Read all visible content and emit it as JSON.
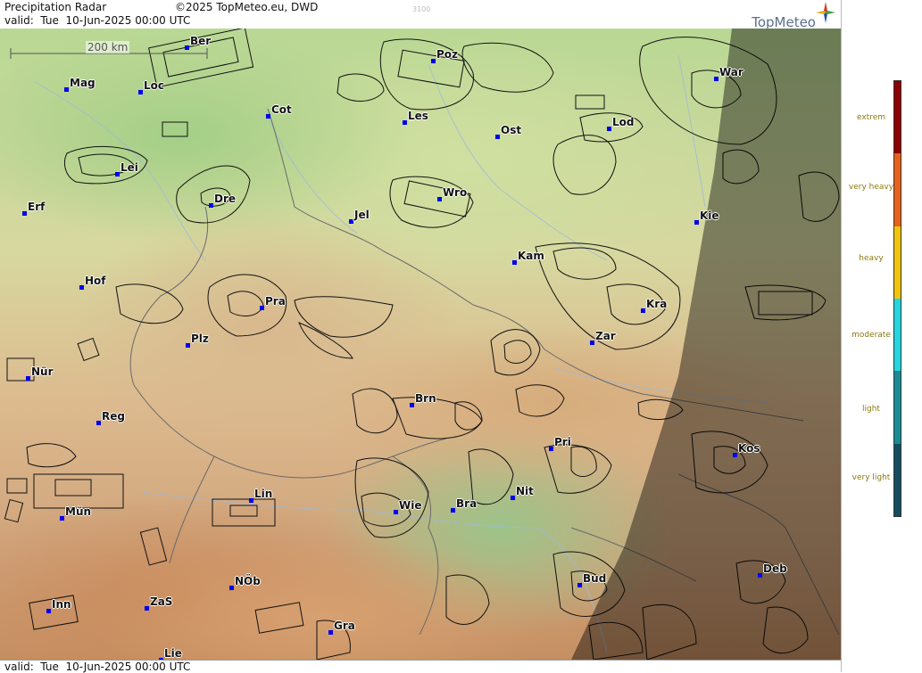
{
  "header": {
    "title": "Precipitation Radar",
    "copyright": "©2025 TopMeteo.eu, DWD",
    "valid": "valid:  Tue  10-Jun-2025 00:00 UTC",
    "watermark": "3100",
    "logo": "TopMeteo"
  },
  "footer": {
    "valid": "valid:  Tue  10-Jun-2025 00:00 UTC"
  },
  "scale_bar": {
    "label": "200 km"
  },
  "cities": [
    {
      "name": "Ber"
    },
    {
      "name": "Poz"
    },
    {
      "name": "War"
    },
    {
      "name": "Mag"
    },
    {
      "name": "Loc"
    },
    {
      "name": "Cot"
    },
    {
      "name": "Les"
    },
    {
      "name": "Ost"
    },
    {
      "name": "Lod"
    },
    {
      "name": "Lei"
    },
    {
      "name": "Dre"
    },
    {
      "name": "Wro"
    },
    {
      "name": "Erf"
    },
    {
      "name": "Jel"
    },
    {
      "name": "Kie"
    },
    {
      "name": "Kam"
    },
    {
      "name": "Hof"
    },
    {
      "name": "Pra"
    },
    {
      "name": "Kra"
    },
    {
      "name": "Plz"
    },
    {
      "name": "Zar"
    },
    {
      "name": "Nür"
    },
    {
      "name": "Brn"
    },
    {
      "name": "Reg"
    },
    {
      "name": "Pri"
    },
    {
      "name": "Kos"
    },
    {
      "name": "Lin"
    },
    {
      "name": "Nit"
    },
    {
      "name": "Wie"
    },
    {
      "name": "Bra"
    },
    {
      "name": "Mün"
    },
    {
      "name": "Bud"
    },
    {
      "name": "Deb"
    },
    {
      "name": "NÖb"
    },
    {
      "name": "Inn"
    },
    {
      "name": "ZaS"
    },
    {
      "name": "Gra"
    },
    {
      "name": "Lie"
    }
  ],
  "legend": {
    "levels": [
      {
        "label": "extrem",
        "color": "#8b0000"
      },
      {
        "label": "very heavy",
        "color": "#e8601c"
      },
      {
        "label": "heavy",
        "color": "#f2c40a"
      },
      {
        "label": "moderate",
        "color": "#22d6e0"
      },
      {
        "label": "light",
        "color": "#1a8a95"
      },
      {
        "label": "very light",
        "color": "#134c5e"
      }
    ]
  },
  "colors": {
    "city_marker": "#0000ee",
    "night_shade": "#000000"
  }
}
